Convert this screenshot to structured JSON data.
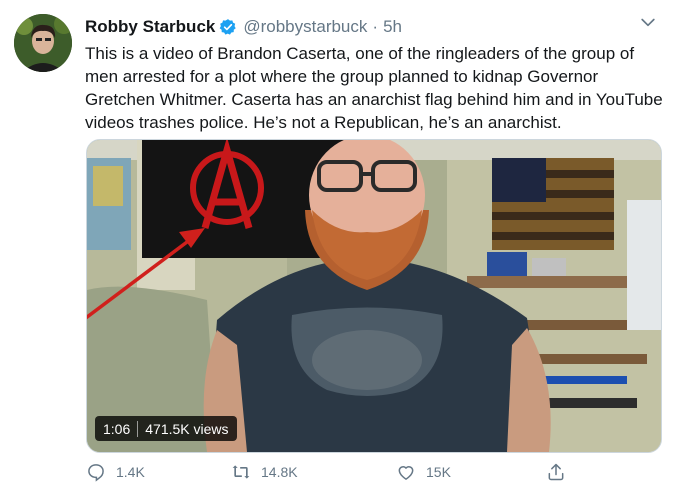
{
  "author": {
    "name": "Robby Starbuck",
    "handle": "@robbystarbuck",
    "separator": "·",
    "time": "5h"
  },
  "tweet": {
    "text": "This is a video of Brandon Caserta, one of the ringleaders of the group of\nmen arrested for a plot where the group planned to kidnap Governor\nGretchen Whitmer. Caserta has an anarchist flag behind him and in YouTube\nvideos trashes police. He’s not a Republican, he’s an anarchist."
  },
  "media": {
    "duration": "1:06",
    "views": "471.5K views"
  },
  "actions": {
    "replies": "1.4K",
    "retweets": "14.8K",
    "likes": "15K"
  },
  "colors": {
    "verified": "#1da1f2",
    "secondary_text": "#657786",
    "annotation_arrow": "#d0201c",
    "anarchy_symbol": "#c8181a"
  },
  "icons": [
    "verified-badge-icon",
    "chevron-down-icon",
    "reply-icon",
    "retweet-icon",
    "like-icon",
    "share-icon"
  ]
}
